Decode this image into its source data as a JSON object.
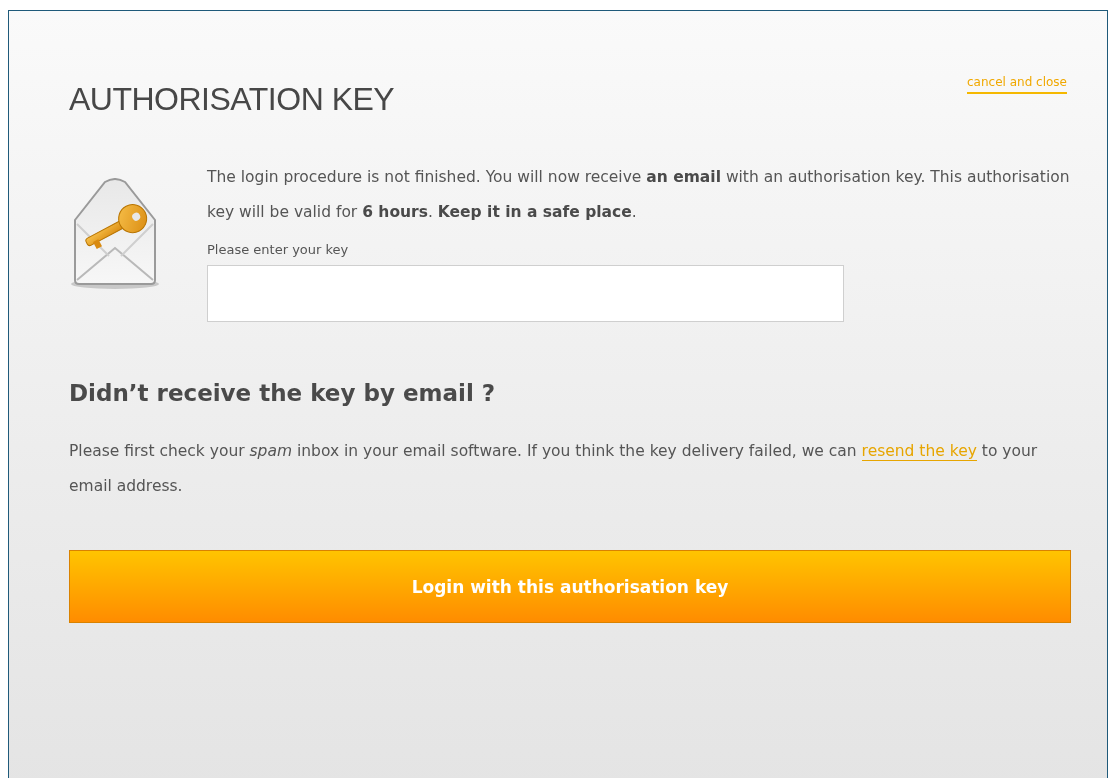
{
  "dialog": {
    "title": "AUTHORISATION KEY",
    "close_link": "cancel and close",
    "message": "The login procedure is not finished. You will now receive **an email** with an authorisation key. This authorisation key will be valid for **6 hours**. **Keep it in a safe place**.",
    "key_field": {
      "label": "Please enter your key"
    },
    "help": {
      "heading": "Didn’t receive the key by email ?",
      "text_before": "Please first check your *spam* inbox in your email software. If you think the key delivery failed, we can",
      "link": "resend the key",
      "text_after": "to your email address."
    },
    "submit_button": "Login with this authorisation key"
  }
}
